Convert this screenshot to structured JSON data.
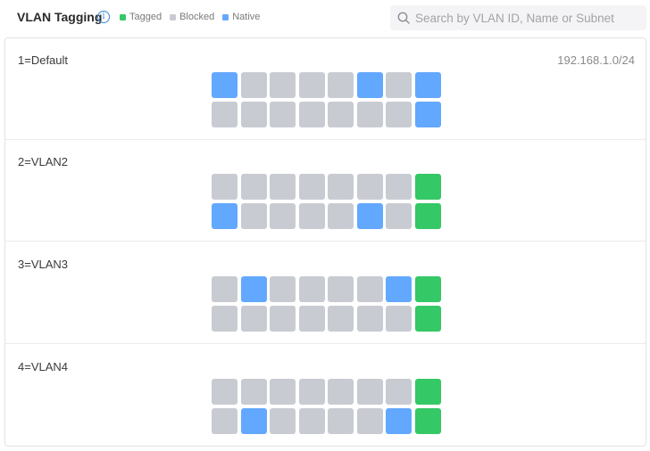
{
  "header": {
    "title": "VLAN Tagging",
    "info_glyph": "i",
    "legend": [
      {
        "key": "tagged",
        "label": "Tagged",
        "color": "#34c866"
      },
      {
        "key": "blocked",
        "label": "Blocked",
        "color": "#c9cbd2"
      },
      {
        "key": "native",
        "label": "Native",
        "color": "#63a8ff"
      }
    ],
    "search": {
      "placeholder": "Search by VLAN ID, Name or Subnet",
      "value": ""
    }
  },
  "vlans": [
    {
      "name": "1=Default",
      "subnet": "192.168.1.0/24",
      "ports": [
        [
          "native",
          "blocked",
          "blocked",
          "blocked",
          "blocked",
          "native",
          "blocked",
          "native"
        ],
        [
          "blocked",
          "blocked",
          "blocked",
          "blocked",
          "blocked",
          "blocked",
          "blocked",
          "native"
        ]
      ]
    },
    {
      "name": "2=VLAN2",
      "subnet": "",
      "ports": [
        [
          "blocked",
          "blocked",
          "blocked",
          "blocked",
          "blocked",
          "blocked",
          "blocked",
          "tagged"
        ],
        [
          "native",
          "blocked",
          "blocked",
          "blocked",
          "blocked",
          "native",
          "blocked",
          "tagged"
        ]
      ]
    },
    {
      "name": "3=VLAN3",
      "subnet": "",
      "ports": [
        [
          "blocked",
          "native",
          "blocked",
          "blocked",
          "blocked",
          "blocked",
          "native",
          "tagged"
        ],
        [
          "blocked",
          "blocked",
          "blocked",
          "blocked",
          "blocked",
          "blocked",
          "blocked",
          "tagged"
        ]
      ]
    },
    {
      "name": "4=VLAN4",
      "subnet": "",
      "ports": [
        [
          "blocked",
          "blocked",
          "blocked",
          "blocked",
          "blocked",
          "blocked",
          "blocked",
          "tagged"
        ],
        [
          "blocked",
          "native",
          "blocked",
          "blocked",
          "blocked",
          "blocked",
          "native",
          "tagged"
        ]
      ]
    }
  ]
}
